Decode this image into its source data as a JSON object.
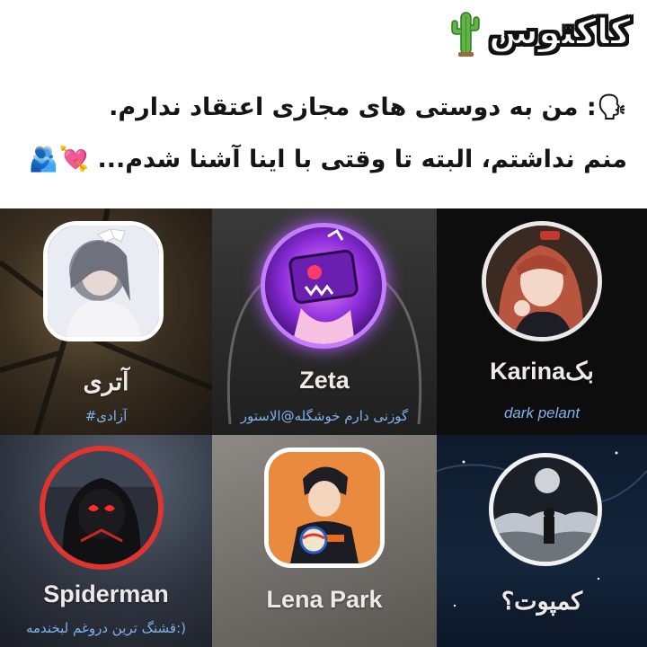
{
  "header": {
    "brand": "کاکتوس",
    "brand_icon": "cactus-icon",
    "line1": "🗣: من به دوستی های مجازی اعتقاد ندارم.",
    "line2": "منم نداشتم، البته تا وقتی با اینا آشنا شدم... 💘🫂"
  },
  "profiles": [
    {
      "name": "آتری",
      "subtitle": "#آزادی",
      "avatar": "girl-photo-avatar"
    },
    {
      "name": "Zeta",
      "subtitle": "گوزنی دارم خوشگله@الاستور",
      "avatar": "purple-tv-character-avatar"
    },
    {
      "name": "Karinaبک",
      "subtitle": "dark pelant",
      "avatar": "girl-red-hair-avatar"
    },
    {
      "name": "Spiderman",
      "subtitle": "قشنگ ترین دروغم لبخندمه:)",
      "avatar": "spiderman-hoodie-avatar"
    },
    {
      "name": "Lena Park",
      "subtitle": "",
      "avatar": "anime-volleyball-avatar"
    },
    {
      "name": "کمپوت؟",
      "subtitle": "",
      "avatar": "night-sky-avatar"
    }
  ],
  "colors": {
    "subtitle_blue": "#7fb2ec",
    "name_white": "#efeaea",
    "accent_red": "#e0342e"
  }
}
